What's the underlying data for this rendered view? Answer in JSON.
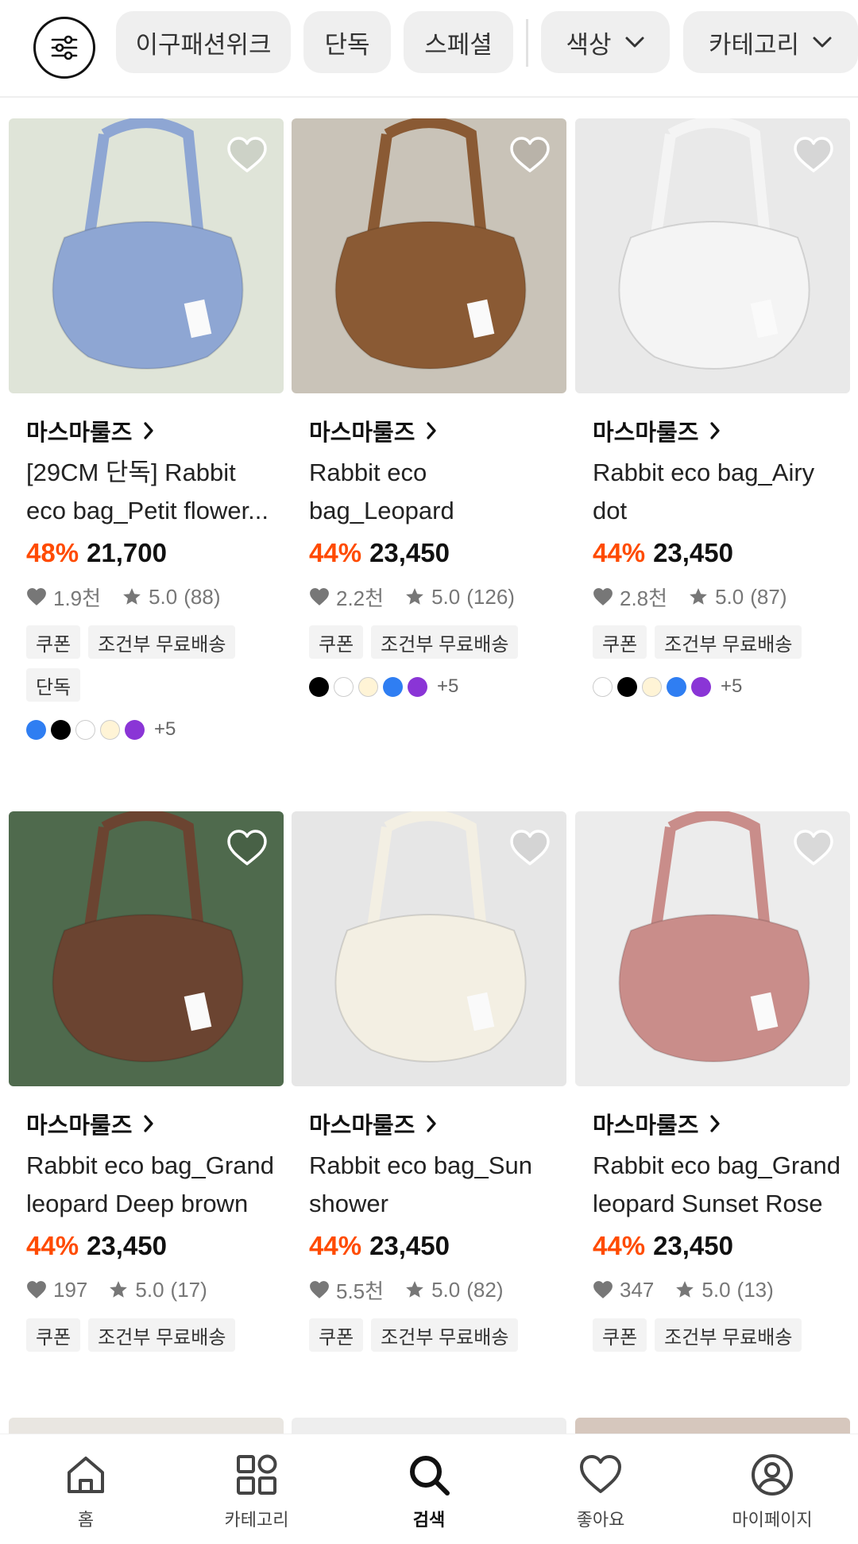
{
  "filters": {
    "chips": [
      {
        "label": "이구패션위크"
      },
      {
        "label": "단독"
      },
      {
        "label": "스페셜"
      },
      {
        "label": "색상"
      },
      {
        "label": "카테고리"
      }
    ]
  },
  "products": [
    {
      "brand": "마스마룰즈",
      "name": "[29CM 단독] Rabbit eco bag_Petit flower...",
      "discount": "48%",
      "price": "21,700",
      "likes": "1.9천",
      "rating": "5.0",
      "reviews": "(88)",
      "tags": [
        "쿠폰",
        "조건부 무료배송",
        "단독"
      ],
      "swatches": [
        "#2f7ef2",
        "#000000",
        "#ffffff",
        "#fff4d6",
        "#8a35d6"
      ],
      "more_colors": "+5",
      "bag_color": "#8ea6d3",
      "bg_color": "#dfe4d8"
    },
    {
      "brand": "마스마룰즈",
      "name": "Rabbit eco bag_Leopard",
      "discount": "44%",
      "price": "23,450",
      "likes": "2.2천",
      "rating": "5.0",
      "reviews": "(126)",
      "tags": [
        "쿠폰",
        "조건부 무료배송"
      ],
      "swatches": [
        "#000000",
        "#ffffff",
        "#fff4d6",
        "#2f7ef2",
        "#8a35d6"
      ],
      "more_colors": "+5",
      "bag_color": "#8a5a34",
      "bg_color": "#c9c3b8"
    },
    {
      "brand": "마스마룰즈",
      "name": "Rabbit eco bag_Airy dot",
      "discount": "44%",
      "price": "23,450",
      "likes": "2.8천",
      "rating": "5.0",
      "reviews": "(87)",
      "tags": [
        "쿠폰",
        "조건부 무료배송"
      ],
      "swatches": [
        "#ffffff",
        "#000000",
        "#fff4d6",
        "#2f7ef2",
        "#8a35d6"
      ],
      "more_colors": "+5",
      "bag_color": "#f4f4f4",
      "bg_color": "#e9e9e9"
    },
    {
      "brand": "마스마룰즈",
      "name": "Rabbit eco bag_Grand leopard Deep brown",
      "discount": "44%",
      "price": "23,450",
      "likes": "197",
      "rating": "5.0",
      "reviews": "(17)",
      "tags": [
        "쿠폰",
        "조건부 무료배송"
      ],
      "swatches": [],
      "more_colors": "",
      "bag_color": "#6b4431",
      "bg_color": "#4f6a4d"
    },
    {
      "brand": "마스마룰즈",
      "name": "Rabbit eco bag_Sun shower",
      "discount": "44%",
      "price": "23,450",
      "likes": "5.5천",
      "rating": "5.0",
      "reviews": "(82)",
      "tags": [
        "쿠폰",
        "조건부 무료배송"
      ],
      "swatches": [],
      "more_colors": "",
      "bag_color": "#f3efe3",
      "bg_color": "#e6e6e6"
    },
    {
      "brand": "마스마룰즈",
      "name": "Rabbit eco bag_Grand leopard Sunset Rose",
      "discount": "44%",
      "price": "23,450",
      "likes": "347",
      "rating": "5.0",
      "reviews": "(13)",
      "tags": [
        "쿠폰",
        "조건부 무료배송"
      ],
      "swatches": [],
      "more_colors": "",
      "bag_color": "#c98d8a",
      "bg_color": "#ececec"
    }
  ],
  "bottom_nav": {
    "items": [
      {
        "label": "홈",
        "icon": "home-icon"
      },
      {
        "label": "카테고리",
        "icon": "grid-icon"
      },
      {
        "label": "검색",
        "icon": "search-icon",
        "active": true
      },
      {
        "label": "좋아요",
        "icon": "heart-icon"
      },
      {
        "label": "마이페이지",
        "icon": "user-circle-icon"
      }
    ]
  },
  "colors": {
    "accent_discount": "#ff4b00",
    "chip_bg": "#efefef",
    "tag_bg": "#f3f3f3"
  }
}
